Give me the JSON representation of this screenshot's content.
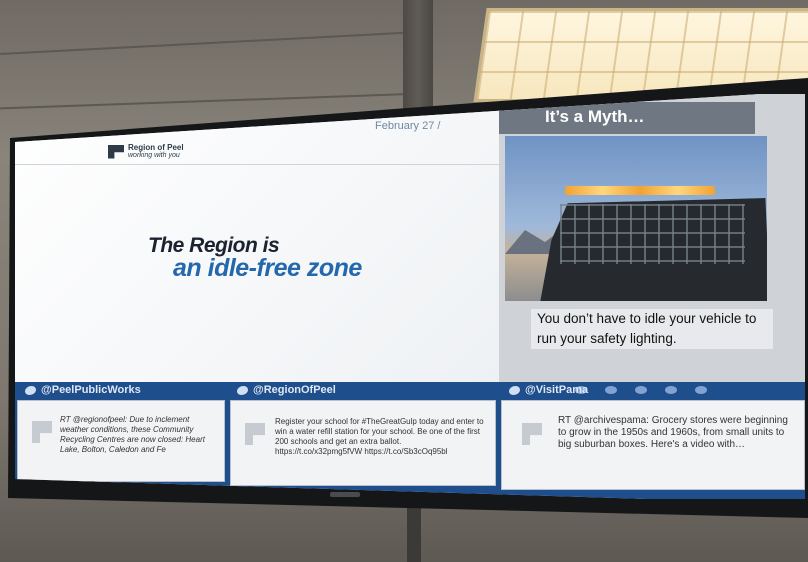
{
  "scene": {
    "description_colors": {
      "screen_blue": "#1f4e8c",
      "accent_blue": "#2367ad",
      "myth_bar": "#6f7782"
    }
  },
  "left_slide": {
    "logo_title": "Region of Peel",
    "logo_subtitle": "working with you",
    "date": "February 27 /",
    "headline_line1": "The Region is",
    "headline_line2": "an idle-free zone"
  },
  "right_slide": {
    "title": "It’s a Myth…",
    "body": "You don’t have to idle your vehicle to run your safety lighting."
  },
  "feeds": [
    {
      "handle": "@PeelPublicWorks",
      "text": "RT @regionofpeel: Due to inclement weather conditions, these Community Recycling Centres are now closed: Heart Lake, Bolton, Caledon and Fe"
    },
    {
      "handle": "@RegionOfPeel",
      "text": "Register your school for #TheGreatGulp today and enter to win a water refill station for your school. Be one of the first 200 schools and get an extra ballot. https://t.co/x32pmg5fVW https://t.co/Sb3cOq95bl"
    },
    {
      "handle": "@VisitPama",
      "text": "RT @archivespama: Grocery stores were beginning to grow in the 1950s and 1960s, from small units to big suburban boxes. Here's a video with…"
    }
  ]
}
